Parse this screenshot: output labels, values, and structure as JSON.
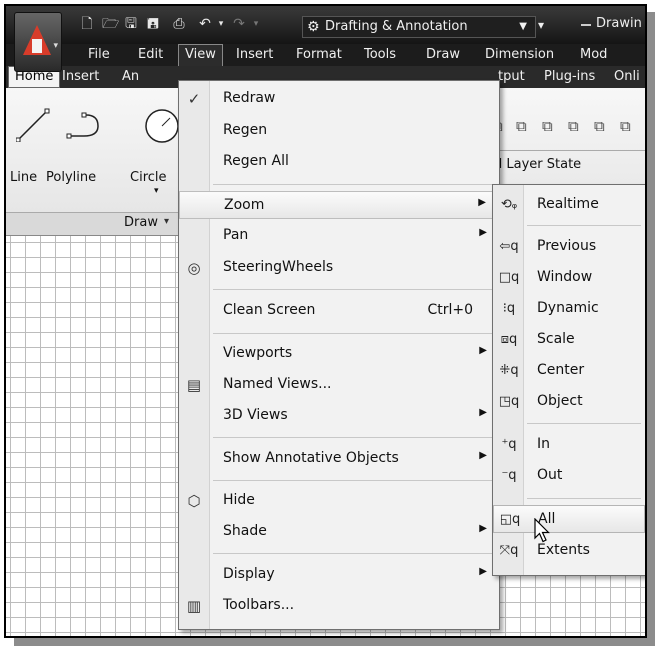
{
  "titlebar": {
    "workspace": "Drafting & Annotation",
    "document_title": "Drawin",
    "icons": [
      "new-icon",
      "open-icon",
      "save-icon",
      "save-as-icon",
      "plot-icon",
      "undo-icon",
      "redo-icon"
    ]
  },
  "menubar": {
    "items": [
      "File",
      "Edit",
      "View",
      "Insert",
      "Format",
      "Tools",
      "Draw",
      "Dimension",
      "Mod"
    ]
  },
  "ribbon": {
    "tabs": [
      "Home",
      "Insert",
      "An",
      "tput",
      "Plug-ins",
      "Onli"
    ],
    "tools": [
      "Line",
      "Polyline",
      "Circle"
    ],
    "panel_label": "Draw",
    "layer_state": "d Layer State"
  },
  "view_menu": {
    "items": [
      {
        "label": "Redraw",
        "icon": "redraw-icon"
      },
      {
        "label": "Regen"
      },
      {
        "label": "Regen All"
      },
      {
        "label": "Zoom",
        "submenu": true
      },
      {
        "label": "Pan",
        "submenu": true
      },
      {
        "label": "SteeringWheels",
        "icon": "steeringwheels-icon"
      },
      {
        "label": "Clean Screen",
        "shortcut": "Ctrl+0"
      },
      {
        "label": "Viewports",
        "submenu": true
      },
      {
        "label": "Named Views...",
        "icon": "named-views-icon"
      },
      {
        "label": "3D Views",
        "submenu": true
      },
      {
        "label": "Show Annotative Objects",
        "submenu": true
      },
      {
        "label": "Hide",
        "icon": "hide-icon"
      },
      {
        "label": "Shade",
        "submenu": true
      },
      {
        "label": "Display",
        "submenu": true
      },
      {
        "label": "Toolbars...",
        "icon": "toolbars-icon"
      }
    ]
  },
  "zoom_menu": {
    "items": [
      {
        "label": "Realtime",
        "icon": "zoom-realtime-icon"
      },
      {
        "label": "Previous",
        "icon": "zoom-previous-icon"
      },
      {
        "label": "Window",
        "icon": "zoom-window-icon"
      },
      {
        "label": "Dynamic",
        "icon": "zoom-dynamic-icon"
      },
      {
        "label": "Scale",
        "icon": "zoom-scale-icon"
      },
      {
        "label": "Center",
        "icon": "zoom-center-icon"
      },
      {
        "label": "Object",
        "icon": "zoom-object-icon"
      },
      {
        "label": "In",
        "icon": "zoom-in-icon"
      },
      {
        "label": "Out",
        "icon": "zoom-out-icon"
      },
      {
        "label": "All",
        "icon": "zoom-all-icon"
      },
      {
        "label": "Extents",
        "icon": "zoom-extents-icon"
      }
    ]
  }
}
